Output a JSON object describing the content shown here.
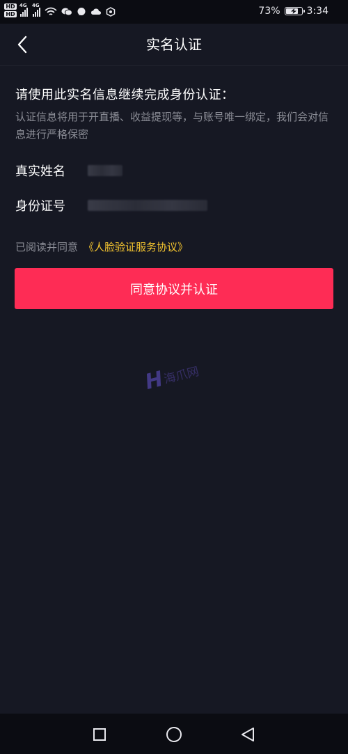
{
  "status_bar": {
    "hd_top": "HD",
    "hd_bottom": "HD",
    "net1": "4G",
    "net2": "4G",
    "battery_percent": "73%",
    "battery_level": 0.73,
    "time": "3:34"
  },
  "header": {
    "title": "实名认证"
  },
  "main": {
    "heading": "请使用此实名信息继续完成身份认证：",
    "description": "认证信息将用于开直播、收益提现等，与账号唯一绑定，我们会对信息进行严格保密",
    "fields": [
      {
        "label": "真实姓名"
      },
      {
        "label": "身份证号"
      }
    ],
    "agreement": {
      "prefix": "已阅读并同意",
      "link": "《人脸验证服务协议》"
    },
    "button_label": "同意协议并认证",
    "watermark": {
      "mark": "H",
      "text": "海爪网"
    }
  },
  "colors": {
    "background": "#161823",
    "primary": "#fe2c55",
    "link": "#f5c52f",
    "muted_text": "#8b8d96"
  },
  "icons": {
    "back": "back-chevron-icon",
    "wifi": "wifi-icon",
    "chat": "chat-bubble-icon",
    "cloud": "cloud-icon",
    "shield": "shield-icon",
    "charging": "charging-icon",
    "recent_apps": "square-icon",
    "home": "circle-icon",
    "back_nav": "triangle-back-icon"
  }
}
